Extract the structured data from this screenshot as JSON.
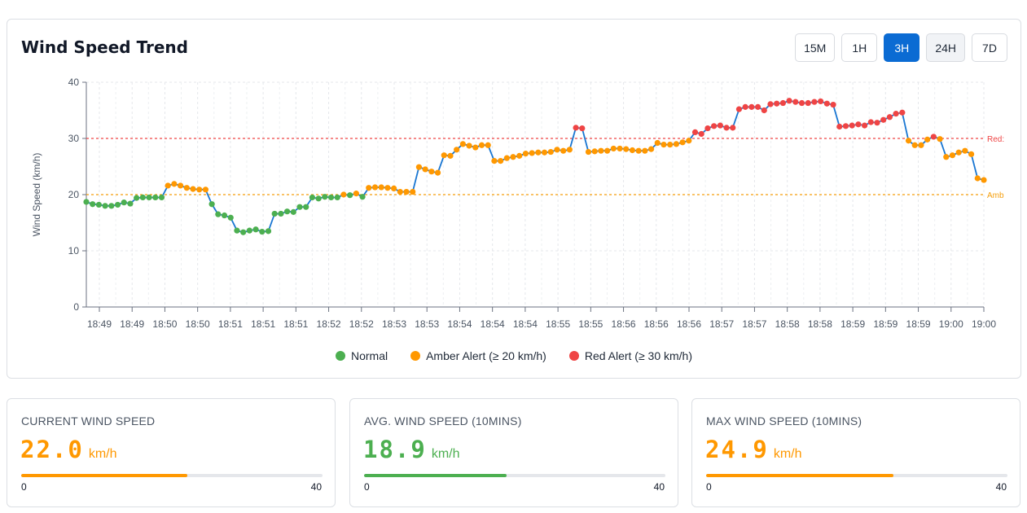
{
  "header": {
    "title": "Wind Speed Trend",
    "ranges": [
      {
        "label": "15M",
        "state": "default"
      },
      {
        "label": "1H",
        "state": "default"
      },
      {
        "label": "3H",
        "state": "active"
      },
      {
        "label": "24H",
        "state": "hover"
      },
      {
        "label": "7D",
        "state": "default"
      }
    ]
  },
  "colors": {
    "normal": "#4caf50",
    "amber": "#ff9800",
    "red": "#ef4444",
    "line": "#1976d2",
    "accent": "#0b6bd3"
  },
  "legend": {
    "normal": "Normal",
    "amber": "Amber Alert (≥ 20 km/h)",
    "red": "Red Alert (≥ 30 km/h)"
  },
  "chart_data": {
    "type": "line",
    "ylabel": "Wind Speed (km/h)",
    "ylim": [
      0,
      40
    ],
    "yticks": [
      0,
      10,
      20,
      30,
      40
    ],
    "grid": true,
    "legend_position": "bottom",
    "x_tick_labels": [
      "18:49",
      "18:49",
      "18:50",
      "18:50",
      "18:51",
      "18:51",
      "18:51",
      "18:52",
      "18:52",
      "18:53",
      "18:53",
      "18:54",
      "18:54",
      "18:54",
      "18:55",
      "18:55",
      "18:56",
      "18:56",
      "18:56",
      "18:57",
      "18:57",
      "18:58",
      "18:58",
      "18:59",
      "18:59",
      "18:59",
      "19:00",
      "19:00"
    ],
    "thresholds": [
      {
        "label": "Red:",
        "value": 30,
        "color": "#ef4444"
      },
      {
        "label": "Amb",
        "value": 20,
        "color": "#f59e0b"
      }
    ],
    "series": [
      {
        "values": [
          18.7,
          18.3,
          18.2,
          18.0,
          18.0,
          18.2,
          18.6,
          18.4,
          19.4,
          19.5,
          19.5,
          19.5,
          19.5,
          21.6,
          21.9,
          21.6,
          21.2,
          21.0,
          20.9,
          20.9,
          18.3,
          16.5,
          16.3,
          15.9,
          13.6,
          13.3,
          13.6,
          13.8,
          13.4,
          13.5,
          16.6,
          16.6,
          17.0,
          16.9,
          17.8,
          17.8,
          19.5,
          19.3,
          19.6,
          19.5,
          19.5,
          20.0,
          19.9,
          20.2,
          19.6,
          21.2,
          21.3,
          21.3,
          21.2,
          21.1,
          20.5,
          20.5,
          20.5,
          24.9,
          24.5,
          24.1,
          23.9,
          27.0,
          26.9,
          28.0,
          29.0,
          28.7,
          28.4,
          28.8,
          28.8,
          26.0,
          26.0,
          26.5,
          26.7,
          26.9,
          27.3,
          27.4,
          27.5,
          27.5,
          27.6,
          28.0,
          27.8,
          28.0,
          31.9,
          31.8,
          27.6,
          27.7,
          27.8,
          27.8,
          28.2,
          28.2,
          28.1,
          27.9,
          27.8,
          27.8,
          28.1,
          29.2,
          28.9,
          28.9,
          29.0,
          29.3,
          29.6,
          31.1,
          30.8,
          31.8,
          32.2,
          32.3,
          31.9,
          31.9,
          35.2,
          35.6,
          35.6,
          35.6,
          35.0,
          36.1,
          36.2,
          36.3,
          36.7,
          36.5,
          36.3,
          36.3,
          36.5,
          36.6,
          36.2,
          36.0,
          32.1,
          32.2,
          32.3,
          32.5,
          32.3,
          32.9,
          32.8,
          33.3,
          33.8,
          34.4,
          34.6,
          29.6,
          28.8,
          28.8,
          29.8,
          30.3,
          29.9,
          26.7,
          27.0,
          27.5,
          27.8,
          27.2,
          22.9,
          22.6
        ]
      }
    ]
  },
  "stats": [
    {
      "label": "CURRENT WIND SPEED",
      "value": "22.0",
      "unit": "km/h",
      "min": "0",
      "max": "40",
      "level": 0.55,
      "color": "#ff9800"
    },
    {
      "label": "AVG. WIND SPEED (10MINS)",
      "value": "18.9",
      "unit": "km/h",
      "min": "0",
      "max": "40",
      "level": 0.4725,
      "color": "#4caf50"
    },
    {
      "label": "MAX WIND SPEED (10MINS)",
      "value": "24.9",
      "unit": "km/h",
      "min": "0",
      "max": "40",
      "level": 0.6225,
      "color": "#ff9800"
    }
  ]
}
